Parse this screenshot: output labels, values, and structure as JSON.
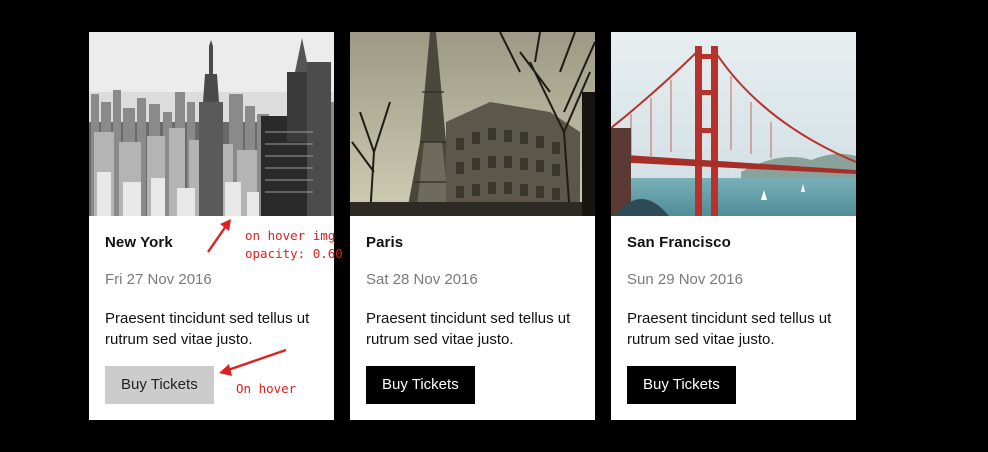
{
  "cards": [
    {
      "city": "New York",
      "date": "Fri 27 Nov 2016",
      "description": "Praesent tincidunt sed tellus ut rutrum sed vitae justo.",
      "button_label": "Buy Tickets",
      "image": "new-york-skyline-photo"
    },
    {
      "city": "Paris",
      "date": "Sat 28 Nov 2016",
      "description": "Praesent tincidunt sed tellus ut rutrum sed vitae justo.",
      "button_label": "Buy Tickets",
      "image": "paris-eiffel-tower-photo"
    },
    {
      "city": "San Francisco",
      "date": "Sun 29 Nov 2016",
      "description": "Praesent tincidunt sed tellus ut rutrum sed vitae justo.",
      "button_label": "Buy Tickets",
      "image": "san-francisco-golden-gate-photo"
    }
  ],
  "annotations": {
    "image_hover_line1": "on hover img",
    "image_hover_line2": "opacity: 0.60",
    "button_hover": "On hover",
    "color": "#e02020"
  },
  "colors": {
    "page_background": "#000000",
    "card_background": "#ffffff",
    "button_background": "#000000",
    "button_hover_background": "#cccccc"
  }
}
